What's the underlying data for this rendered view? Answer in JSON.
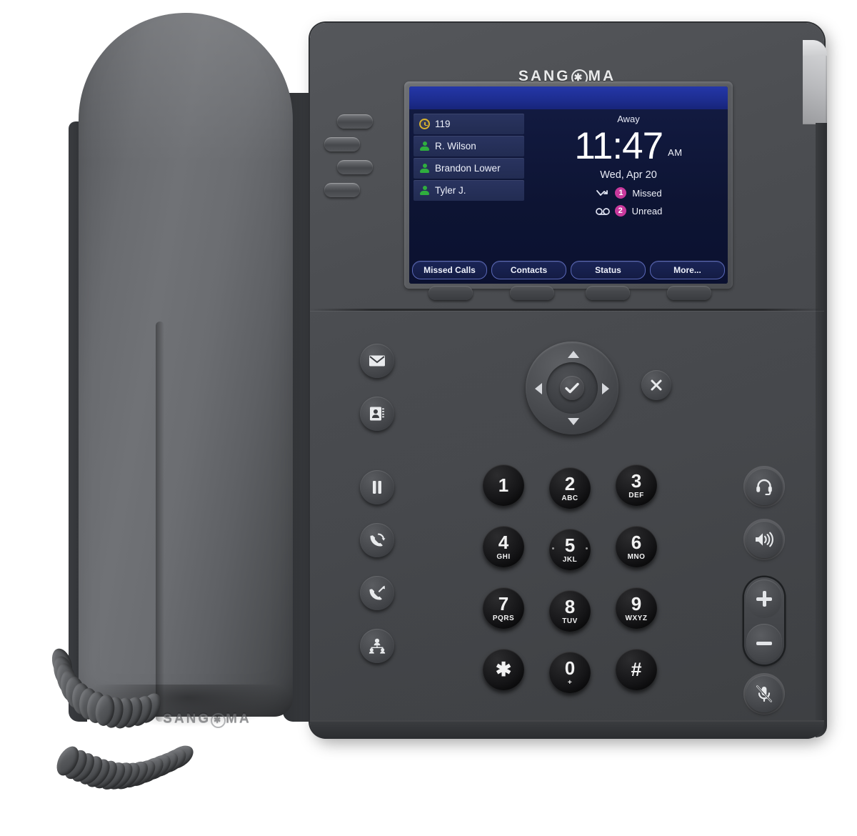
{
  "product": {
    "brand": "SANGOMA",
    "brand_mark_icon": "asterisk-in-circle-icon",
    "base_brand": "SANGOMA"
  },
  "screen": {
    "line_keys": [
      {
        "label": "119",
        "icon": "clock-icon",
        "icon_color": "#d8b22e"
      },
      {
        "label": "R. Wilson",
        "icon": "presence-available-icon",
        "icon_color": "#2fae3e"
      },
      {
        "label": "Brandon Lower",
        "icon": "presence-available-icon",
        "icon_color": "#2fae3e"
      },
      {
        "label": "Tyler J.",
        "icon": "presence-available-icon",
        "icon_color": "#2fae3e"
      }
    ],
    "presence_status": "Away",
    "time": "11:47",
    "meridiem": "AM",
    "date": "Wed, Apr 20",
    "notifications": [
      {
        "icon": "missed-call-icon",
        "count": "1",
        "label": "Missed"
      },
      {
        "icon": "voicemail-icon",
        "count": "2",
        "label": "Unread"
      }
    ],
    "soft_keys": [
      "Missed Calls",
      "Contacts",
      "Status",
      "More..."
    ],
    "colors": {
      "status_bar": "#1d2d8f",
      "screen_bg": "#0d1433",
      "line_key_bg": "#262f58",
      "badge": "#c8399c",
      "text": "#ffffff"
    }
  },
  "hard_keys": {
    "line_buttons": [
      "line-key-1",
      "line-key-2",
      "line-key-3",
      "line-key-4"
    ],
    "soft_key_buttons": [
      "soft-key-1",
      "soft-key-2",
      "soft-key-3",
      "soft-key-4"
    ],
    "left_function_keys": [
      {
        "name": "voicemail-button",
        "icon": "envelope-icon"
      },
      {
        "name": "directory-button",
        "icon": "contact-card-icon"
      },
      {
        "name": "hold-button",
        "icon": "pause-icon"
      },
      {
        "name": "redial-button",
        "icon": "handset-redial-icon"
      },
      {
        "name": "transfer-button",
        "icon": "handset-transfer-icon"
      },
      {
        "name": "conference-button",
        "icon": "people-group-icon"
      }
    ],
    "right_function_keys": [
      {
        "name": "headset-button",
        "icon": "headset-icon"
      },
      {
        "name": "speakerphone-button",
        "icon": "speaker-icon"
      },
      {
        "name": "volume-up-button",
        "icon": "plus-icon"
      },
      {
        "name": "volume-down-button",
        "icon": "minus-icon"
      },
      {
        "name": "mute-button",
        "icon": "microphone-muted-icon"
      }
    ],
    "navigation": {
      "up": "▲",
      "down": "▼",
      "left": "◀",
      "right": "▶",
      "select_icon": "checkmark-icon",
      "cancel_icon": "x-icon"
    },
    "keypad": [
      {
        "digit": "1",
        "letters": ""
      },
      {
        "digit": "2",
        "letters": "ABC"
      },
      {
        "digit": "3",
        "letters": "DEF"
      },
      {
        "digit": "4",
        "letters": "GHI"
      },
      {
        "digit": "5",
        "letters": "JKL"
      },
      {
        "digit": "6",
        "letters": "MNO"
      },
      {
        "digit": "7",
        "letters": "PQRS"
      },
      {
        "digit": "8",
        "letters": "TUV"
      },
      {
        "digit": "9",
        "letters": "WXYZ"
      },
      {
        "digit": "✱",
        "letters": ""
      },
      {
        "digit": "0",
        "letters": "+"
      },
      {
        "digit": "#",
        "letters": ""
      }
    ]
  }
}
